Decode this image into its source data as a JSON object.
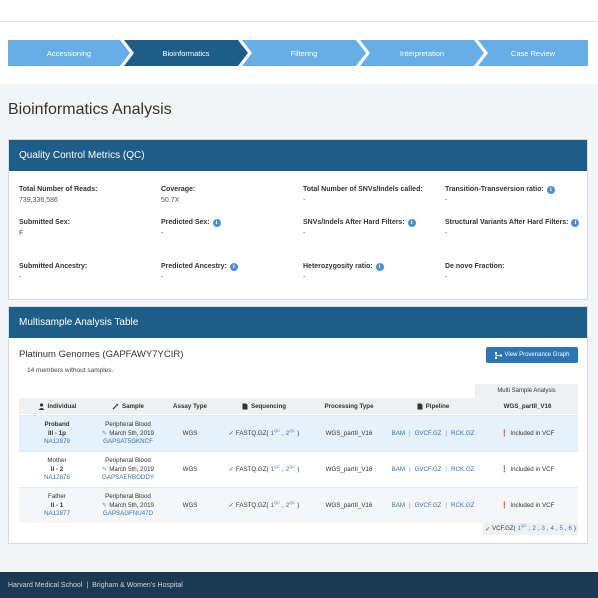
{
  "steps": [
    "Accessioning",
    "Bioinformatics",
    "Filtering",
    "Interpretation",
    "Case Review"
  ],
  "page_title": "Bioinformatics Analysis",
  "qc": {
    "title": "Quality Control Metrics (QC)",
    "items": [
      {
        "label": "Total Number of Reads:",
        "value": "739,336,586"
      },
      {
        "label": "Coverage:",
        "value": "50.7X"
      },
      {
        "label": "Total Number of SNVs/Indels called:",
        "value": "-"
      },
      {
        "label": "Transition-Transversion ratio:",
        "value": "-"
      },
      {
        "label": "Submitted Sex:",
        "value": "F"
      },
      {
        "label": "Predicted Sex:",
        "value": "-"
      },
      {
        "label": "SNVs/Indels After Hard Filters:",
        "value": "-"
      },
      {
        "label": "Structural Variants After Hard Filters:",
        "value": "-"
      },
      {
        "label": "Submitted Ancestry:",
        "value": "-"
      },
      {
        "label": "Predicted Ancestry:",
        "value": "-"
      },
      {
        "label": "Heterozygosity ratio:",
        "value": "-"
      },
      {
        "label": "De novo Fraction:",
        "value": "-"
      }
    ]
  },
  "ms": {
    "title": "Multisample Analysis Table",
    "family_title": "Platinum Genomes (GAPFAWY7YCIR)",
    "members_note": "14 members without samples.",
    "provenance_button": "View Provenance Graph",
    "group_header": "Multi Sample Analysis",
    "headers": {
      "individual": "Individual",
      "sample": "Sample",
      "assay": "Assay Type",
      "sequencing": "Sequencing",
      "processing": "Processing Type",
      "pipeline": "Pipeline",
      "wgs": "WGS_partII_V16"
    },
    "rows": [
      {
        "relation": "Proband",
        "generation": "III - 1p",
        "individual_id": "NA12879",
        "sample_type": "Peripheral Blood",
        "sample_date": "March 5th, 2019",
        "sample_id": "GAPSAT5GKNCF",
        "assay": "WGS",
        "seq_file": "FASTQ.GZ(",
        "seq_1": "1",
        "seq_2": "2",
        "qc": "QC",
        "processing": "WGS_partII_V16",
        "pipeline": [
          "BAM",
          "GVCF.GZ",
          "RCK.GZ"
        ],
        "vcf_status": "Included in VCF"
      },
      {
        "relation": "Mother",
        "generation": "II - 2",
        "individual_id": "NA12878",
        "sample_type": "Peripheral Blood",
        "sample_date": "March 5th, 2019",
        "sample_id": "GAPSAERBODDY",
        "assay": "WGS",
        "seq_file": "FASTQ.GZ(",
        "seq_1": "1",
        "seq_2": "2",
        "qc": "QC",
        "processing": "WGS_partII_V16",
        "pipeline": [
          "BAM",
          "GVCF.GZ",
          "RCK.GZ"
        ],
        "vcf_status": "Included in VCF"
      },
      {
        "relation": "Father",
        "generation": "II - 1",
        "individual_id": "NA12877",
        "sample_type": "Peripheral Blood",
        "sample_date": "March 5th, 2019",
        "sample_id": "GAPSAGFNU47D",
        "assay": "WGS",
        "seq_file": "FASTQ.GZ(",
        "seq_1": "1",
        "seq_2": "2",
        "qc": "QC",
        "processing": "WGS_partII_V16",
        "pipeline": [
          "BAM",
          "GVCF.GZ",
          "RCK.GZ"
        ],
        "vcf_status": "Included in VCF"
      }
    ],
    "vcf_summary": {
      "prefix": "VCF.GZ(",
      "first": "1",
      "qc": "QC",
      "others": [
        "2",
        "3",
        "4",
        "5",
        "6"
      ],
      "suffix": ")"
    }
  },
  "footer": {
    "left": "Harvard Medical School",
    "divider": "|",
    "right": "Brigham & Women's Hospital"
  },
  "colors": {
    "step_active": "#1e5d88",
    "step_inactive": "#67aee6",
    "panel_header": "#1e5d88",
    "link": "#2d75b5",
    "footer": "#1b3a52"
  }
}
